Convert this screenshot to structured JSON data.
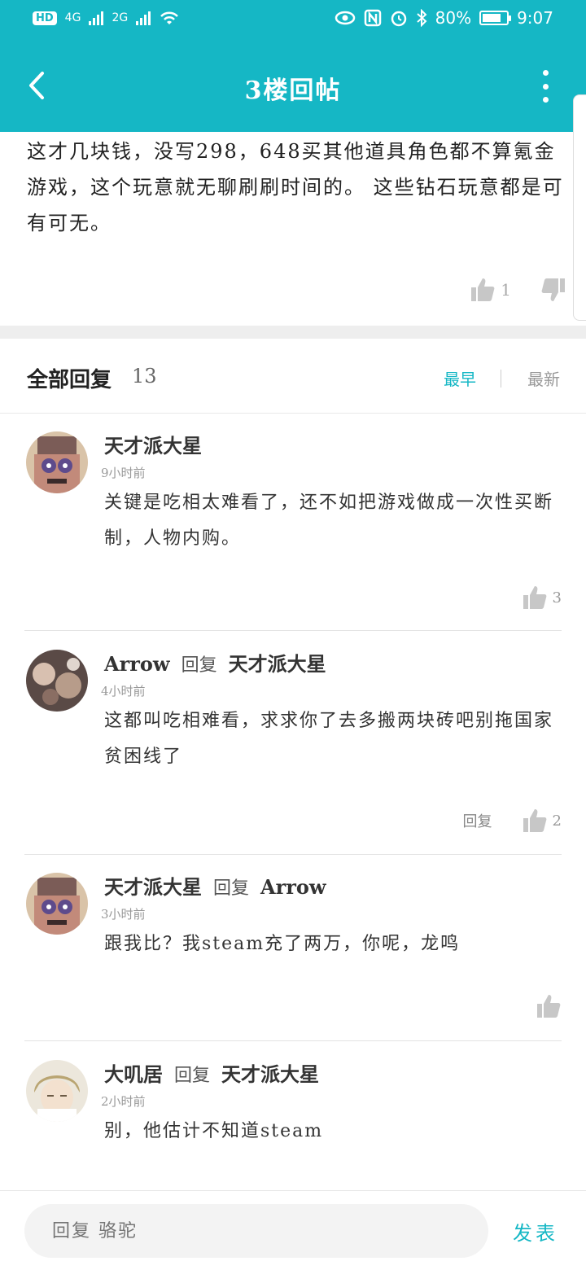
{
  "status_bar": {
    "hd": "HD",
    "net1": "4G",
    "net2": "2G",
    "battery": "80%",
    "battery_level": 0.8,
    "time": "9:07"
  },
  "header": {
    "title": "3楼回帖"
  },
  "post": {
    "text": "这才几块钱，没写298，648买其他道具角色都不算氪金游戏，这个玩意就无聊刷刷时间的。 这些钻石玩意都是可有可无。",
    "likes": "1"
  },
  "replies_header": {
    "label": "全部回复",
    "count": "13",
    "sort_earliest": "最早",
    "sort_newest": "最新"
  },
  "replies": [
    {
      "author": "天才派大星",
      "reply_word": "",
      "reply_to": "",
      "time": "9小时前",
      "text": "关键是吃相太难看了，还不如把游戏做成一次性买断制，人物内购。",
      "reply_label": "",
      "likes": "3"
    },
    {
      "author": "Arrow",
      "reply_word": "回复",
      "reply_to": "天才派大星",
      "time": "4小时前",
      "text": "这都叫吃相难看，求求你了去多搬两块砖吧别拖国家贫困线了",
      "reply_label": "回复",
      "likes": "2"
    },
    {
      "author": "天才派大星",
      "reply_word": "回复",
      "reply_to": "Arrow",
      "time": "3小时前",
      "text": "跟我比？我steam充了两万，你呢，龙鸣",
      "reply_label": "",
      "likes": ""
    },
    {
      "author": "大叽居",
      "reply_word": "回复",
      "reply_to": "天才派大星",
      "time": "2小时前",
      "text": "别，他估计不知道steam",
      "reply_label": "",
      "likes": ""
    }
  ],
  "bottom_bar": {
    "placeholder": "回复 骆驼",
    "send": "发表"
  },
  "colors": {
    "accent": "#15b7c5"
  }
}
